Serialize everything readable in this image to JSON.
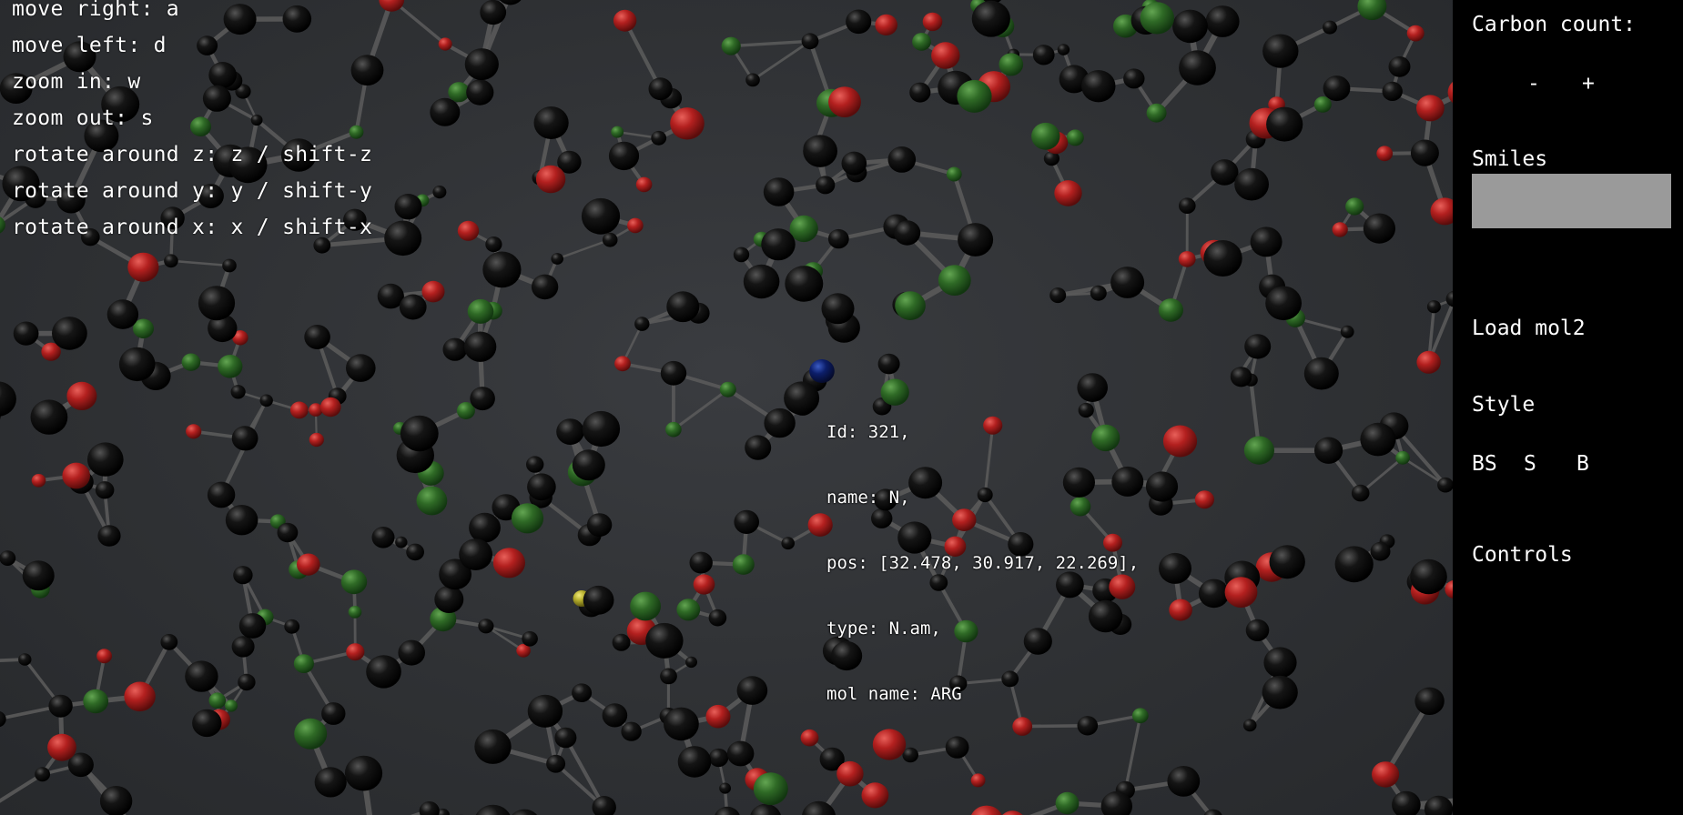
{
  "controls_help": [
    "move right: a",
    "move left: d",
    "zoom in: w",
    "zoom out: s",
    "rotate around z: z / shift-z",
    "rotate around y: y / shift-y",
    "rotate around x: x / shift-x"
  ],
  "atom_info": {
    "id": "Id: 321,",
    "name": "name: N,",
    "pos": "pos: [32.478, 30.917, 22.269],",
    "type": "type: N.am,",
    "mol_name": "mol name: ARG"
  },
  "sidebar": {
    "carbon_count_label": "Carbon count:",
    "decrement_label": "-",
    "increment_label": "+",
    "smiles_label": "Smiles",
    "smiles_value": "",
    "load_mol2_label": "Load mol2",
    "style_label": "Style",
    "style_bs": "BS",
    "style_s": "S",
    "style_b": "B",
    "controls_label": "Controls"
  },
  "colors": {
    "carbon": "#0b0b0b",
    "oxygen": "#b3201f",
    "chlorine": "#2f6a26",
    "nitrogen_selected": "#0c1e6a",
    "sulfur": "#b5ae2c",
    "bond": "#5a5a5a"
  }
}
